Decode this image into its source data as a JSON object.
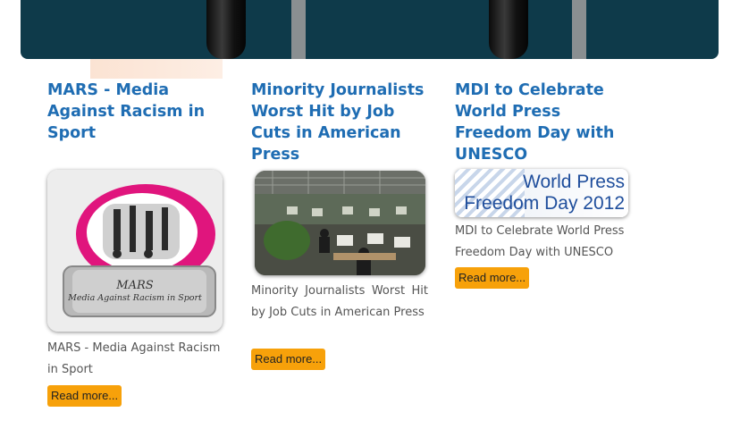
{
  "articles": [
    {
      "title": "MARS - Media Against Racism in Sport",
      "image_alt_text": "MARS",
      "image_subtitle": "Media Against Racism in Sport",
      "description": "MARS - Media Against Racism in Sport",
      "read_more": "Read more..."
    },
    {
      "title": "Minority Journalists Worst Hit by Job Cuts in American Press",
      "description": "Minority Journalists Worst Hit by Job Cuts in American Press",
      "read_more": "Read more..."
    },
    {
      "title": "MDI to Celebrate World Press Freedom Day with UNESCO",
      "image_line1": "World Press",
      "image_line2": "Freedom Day 2012",
      "description": "MDI to Celebrate World Press Freedom Day with UNESCO",
      "read_more": "Read more..."
    }
  ],
  "colors": {
    "title": "#1f6db3",
    "button": "#f7a10a",
    "banner": "#0e3a4a"
  }
}
